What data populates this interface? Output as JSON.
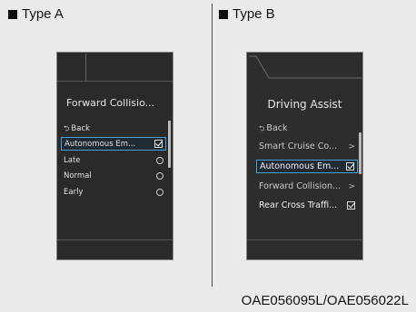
{
  "type_a": {
    "label": "Type A",
    "title": "Forward Collisio...",
    "items": [
      {
        "label": "Back",
        "control": "back"
      },
      {
        "label": "Autonomous Em...",
        "control": "check",
        "selected": true
      },
      {
        "label": "Late",
        "control": "radio"
      },
      {
        "label": "Normal",
        "control": "radio"
      },
      {
        "label": "Early",
        "control": "radio"
      }
    ]
  },
  "type_b": {
    "label": "Type B",
    "title": "Driving Assist",
    "items": [
      {
        "label": "Back",
        "control": "back"
      },
      {
        "label": "Smart Cruise Co...",
        "control": "chevron"
      },
      {
        "label": "Autonomous Em...",
        "control": "check",
        "selected": true
      },
      {
        "label": "Forward Collision...",
        "control": "chevron"
      },
      {
        "label": "Rear Cross Traffi...",
        "control": "check"
      }
    ]
  },
  "caption": "OAE056095L/OAE056022L",
  "colors": {
    "highlight": "#4aa0d8",
    "screen_bg": "#2a2a2a"
  },
  "icons": {
    "back": "back-arrow-icon",
    "check": "checkbox-icon",
    "radio": "radio-icon",
    "chevron": "chevron-right-icon"
  }
}
